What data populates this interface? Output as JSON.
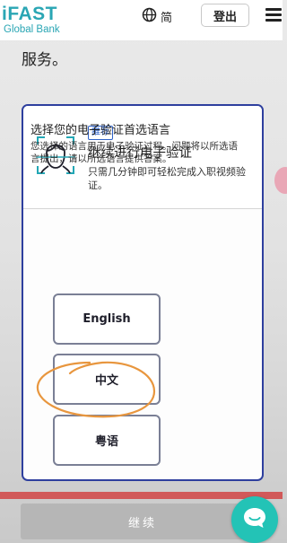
{
  "header": {
    "logo_primary": "iFAST",
    "logo_secondary": "Global Bank",
    "language_label": "简",
    "logout_label": "登出"
  },
  "page": {
    "services_text": "服务。"
  },
  "card": {
    "badge": "推荐",
    "title": "继续进行电子验证",
    "description": "只需几分钟即可轻松完成入职视频验证。",
    "language_heading": "选择您的电子验证首选语言",
    "language_description": "您选择的语言用于电子验证过程。问题将以所选语言提出，请以所选语言提供答案。",
    "options": [
      {
        "label": "English"
      },
      {
        "label": "中文"
      },
      {
        "label": "粤语"
      }
    ]
  },
  "footer": {
    "continue_label": "继续"
  },
  "colors": {
    "brand_teal": "#2aa6b4",
    "card_border": "#2e3f9e",
    "badge_blue": "#2e62c9",
    "annotation_orange": "#e8963e",
    "chat_teal": "#23c3b6",
    "disabled_button": "#b6b6b6"
  },
  "icons": [
    "globe-icon",
    "menu-icon",
    "face-scan-icon",
    "chat-icon"
  ]
}
